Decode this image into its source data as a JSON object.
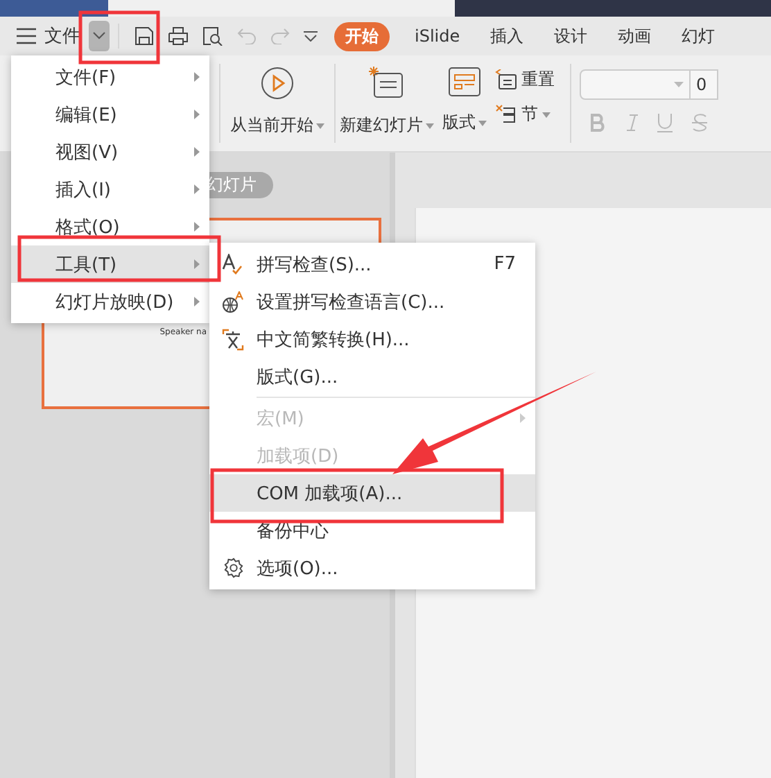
{
  "toolbar": {
    "menu_label": "文件"
  },
  "tabs": [
    {
      "label": "开始",
      "selected": true
    },
    {
      "label": "iSlide",
      "selected": false
    },
    {
      "label": "插入",
      "selected": false
    },
    {
      "label": "设计",
      "selected": false
    },
    {
      "label": "动画",
      "selected": false
    },
    {
      "label": "幻灯",
      "selected": false
    }
  ],
  "ribbon": {
    "play_from_current": "从当前开始",
    "new_slide": "新建幻灯片",
    "layout": "版式",
    "reset": "重置",
    "section": "节",
    "font_size": "0"
  },
  "slide_panel": {
    "tab": "幻灯片",
    "speaker_note": "Speaker na"
  },
  "main_menu": [
    {
      "label": "文件(F)",
      "selected": false
    },
    {
      "label": "编辑(E)",
      "selected": false
    },
    {
      "label": "视图(V)",
      "selected": false
    },
    {
      "label": "插入(I)",
      "selected": false
    },
    {
      "label": "格式(O)",
      "selected": false
    },
    {
      "label": "工具(T)",
      "selected": true
    },
    {
      "label": "幻灯片放映(D)",
      "selected": false
    }
  ],
  "tools_menu": [
    {
      "kind": "spell",
      "label": "拼写检查(S)...",
      "shortcut": "F7",
      "disabled": false,
      "selected": false
    },
    {
      "kind": "language",
      "label": "设置拼写检查语言(C)...",
      "disabled": false,
      "selected": false
    },
    {
      "kind": "convert",
      "label": "中文简繁转换(H)...",
      "disabled": false,
      "selected": false
    },
    {
      "kind": "plain",
      "label": "版式(G)...",
      "disabled": false,
      "selected": false
    },
    {
      "kind": "separator"
    },
    {
      "kind": "submenu",
      "label": "宏(M)",
      "disabled": true,
      "selected": false
    },
    {
      "kind": "plain",
      "label": "加载项(D)",
      "disabled": true,
      "selected": false
    },
    {
      "kind": "plain",
      "label": "COM 加载项(A)...",
      "disabled": false,
      "selected": true
    },
    {
      "kind": "plain",
      "label": "备份中心",
      "disabled": false,
      "selected": false
    },
    {
      "kind": "options",
      "label": "选项(O)...",
      "disabled": false,
      "selected": false
    }
  ]
}
